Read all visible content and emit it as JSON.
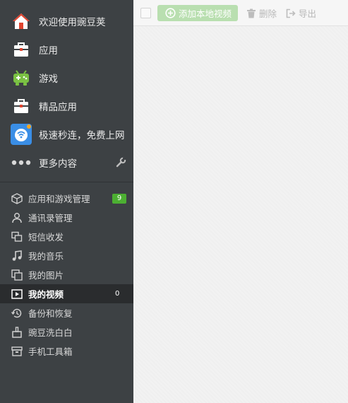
{
  "sidebar": {
    "top_items": [
      {
        "label": "欢迎使用豌豆荚",
        "icon": "home-icon"
      },
      {
        "label": "应用",
        "icon": "app-bag-icon"
      },
      {
        "label": "游戏",
        "icon": "gamepad-icon"
      },
      {
        "label": "精品应用",
        "icon": "app-bag-icon"
      },
      {
        "label": "极速秒连，免费上网",
        "icon": "wifi-icon"
      },
      {
        "label": "更多内容",
        "icon": "more-dots-icon",
        "tool_icon": "wrench-icon"
      }
    ],
    "manage_items": [
      {
        "label": "应用和游戏管理",
        "icon": "cube-icon",
        "badge": "9"
      },
      {
        "label": "通讯录管理",
        "icon": "person-icon"
      },
      {
        "label": "短信收发",
        "icon": "message-icon"
      },
      {
        "label": "我的音乐",
        "icon": "music-note-icon"
      },
      {
        "label": "我的图片",
        "icon": "images-icon"
      },
      {
        "label": "我的视频",
        "icon": "video-play-icon",
        "badge": "0",
        "active": true
      },
      {
        "label": "备份和恢复",
        "icon": "history-icon"
      },
      {
        "label": "豌豆洗白白",
        "icon": "clean-icon"
      },
      {
        "label": "手机工具箱",
        "icon": "toolbox-icon"
      }
    ]
  },
  "toolbar": {
    "add_label": "添加本地视频",
    "delete_label": "删除",
    "export_label": "导出"
  },
  "colors": {
    "sidebar_bg": "#3d4144",
    "active_bg": "#2a2c2e",
    "badge_green": "#4caf32",
    "add_button": "#b9dfb0"
  }
}
